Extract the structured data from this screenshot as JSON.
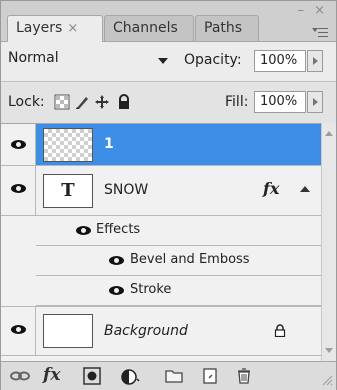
{
  "tabs": [
    {
      "label": "Layers",
      "close": "×",
      "active": true
    },
    {
      "label": "Channels",
      "active": false
    },
    {
      "label": "Paths",
      "active": false
    }
  ],
  "window_controls": "– ×",
  "blend_mode": "Normal",
  "opacity": {
    "label": "Opacity:",
    "value": "100%"
  },
  "lock": {
    "label": "Lock:",
    "icons": [
      "lock-transparent-icon",
      "lock-image-icon",
      "lock-position-icon",
      "lock-all-icon"
    ]
  },
  "fill": {
    "label": "Fill:",
    "value": "100%"
  },
  "layers": [
    {
      "name": "1",
      "selected": true,
      "thumb": "transparent"
    },
    {
      "name": "SNOW",
      "thumb_label": "T",
      "fx": "fx",
      "effects_label": "Effects",
      "effects": [
        "Bevel and Emboss",
        "Stroke"
      ]
    },
    {
      "name": "Background",
      "locked": true
    }
  ],
  "footer_icons": [
    "link-layers-icon",
    "fx-icon",
    "layer-mask-icon",
    "adjustment-layer-icon",
    "new-group-icon",
    "new-layer-icon",
    "delete-layer-icon"
  ],
  "footer_fx": "fx",
  "colors": {
    "selection": "#3d8ee6",
    "panel": "#d7d7d7"
  }
}
